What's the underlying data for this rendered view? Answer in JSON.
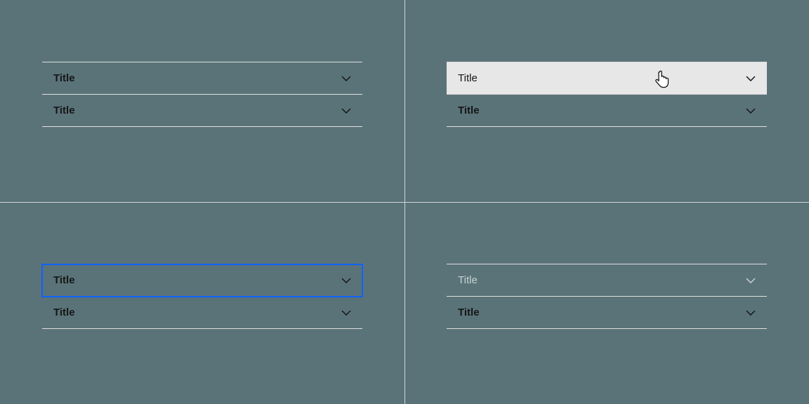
{
  "component": "accordion",
  "states": {
    "default": {
      "items": [
        {
          "label": "Title"
        },
        {
          "label": "Title"
        }
      ]
    },
    "hover": {
      "items": [
        {
          "label": "Title",
          "hovered": true
        },
        {
          "label": "Title"
        }
      ]
    },
    "focus": {
      "items": [
        {
          "label": "Title",
          "focused": true
        },
        {
          "label": "Title"
        }
      ]
    },
    "disabled": {
      "items": [
        {
          "label": "Title",
          "disabled": true
        },
        {
          "label": "Title"
        }
      ]
    }
  },
  "colors": {
    "background": "#5a7379",
    "divider": "#cfd4d5",
    "border": "#e0e0e0",
    "text": "#161616",
    "hover_bg": "#e7e7e7",
    "focus_outline": "#0f62fe",
    "disabled_text": "#c7d0d2"
  },
  "icons": {
    "chevron_down": "chevron-down-icon",
    "cursor_hand": "cursor-pointer-icon"
  }
}
